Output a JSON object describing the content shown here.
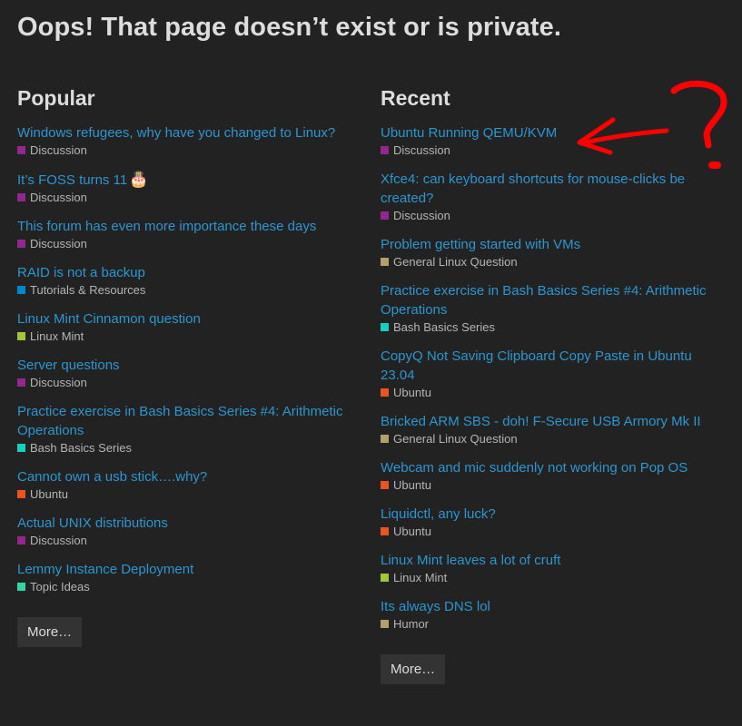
{
  "page": {
    "title": "Oops! That page doesn’t exist or is private."
  },
  "popular": {
    "heading": "Popular",
    "more_label": "More…",
    "topics": [
      {
        "title": "Windows refugees, why have you changed to Linux?",
        "category": "Discussion",
        "color": "#92278f"
      },
      {
        "title": "It’s FOSS turns 11",
        "emoji": "🎂",
        "category": "Discussion",
        "color": "#92278f"
      },
      {
        "title": "This forum has even more importance these days",
        "category": "Discussion",
        "color": "#92278f"
      },
      {
        "title": "RAID is not a backup",
        "category": "Tutorials & Resources",
        "color": "#0088cc"
      },
      {
        "title": "Linux Mint Cinnamon question",
        "category": "Linux Mint",
        "color": "#a3c639"
      },
      {
        "title": "Server questions",
        "category": "Discussion",
        "color": "#92278f"
      },
      {
        "title": "Practice exercise in Bash Basics Series #4: Arithmetic Operations",
        "category": "Bash Basics Series",
        "color": "#12d1c0"
      },
      {
        "title": "Cannot own a usb stick….why?",
        "category": "Ubuntu",
        "color": "#e95420"
      },
      {
        "title": "Actual UNIX distributions",
        "category": "Discussion",
        "color": "#92278f"
      },
      {
        "title": "Lemmy Instance Deployment",
        "category": "Topic Ideas",
        "color": "#2fd7a4"
      }
    ]
  },
  "recent": {
    "heading": "Recent",
    "more_label": "More…",
    "topics": [
      {
        "title": "Ubuntu Running QEMU/KVM",
        "category": "Discussion",
        "color": "#92278f"
      },
      {
        "title": "Xfce4: can keyboard shortcuts for mouse-clicks be created?",
        "category": "Discussion",
        "color": "#92278f"
      },
      {
        "title": "Problem getting started with VMs",
        "category": "General Linux Question",
        "color": "#b3a06a"
      },
      {
        "title": "Practice exercise in Bash Basics Series #4: Arithmetic Operations",
        "category": "Bash Basics Series",
        "color": "#12d1c0"
      },
      {
        "title": "CopyQ Not Saving Clipboard Copy Paste in Ubuntu 23.04",
        "category": "Ubuntu",
        "color": "#e95420"
      },
      {
        "title": "Bricked ARM SBS - doh! F-Secure USB Armory Mk II",
        "category": "General Linux Question",
        "color": "#b3a06a"
      },
      {
        "title": "Webcam and mic suddenly not working on Pop OS",
        "category": "Ubuntu",
        "color": "#e95420"
      },
      {
        "title": "Liquidctl, any luck?",
        "category": "Ubuntu",
        "color": "#e95420"
      },
      {
        "title": "Linux Mint leaves a lot of cruft",
        "category": "Linux Mint",
        "color": "#a3c639"
      },
      {
        "title": "Its always DNS lol",
        "category": "Humor",
        "color": "#b3a06a"
      }
    ]
  },
  "annotation": {
    "color": "#ff0000",
    "icon": "hand-drawn-arrow-question-mark"
  }
}
